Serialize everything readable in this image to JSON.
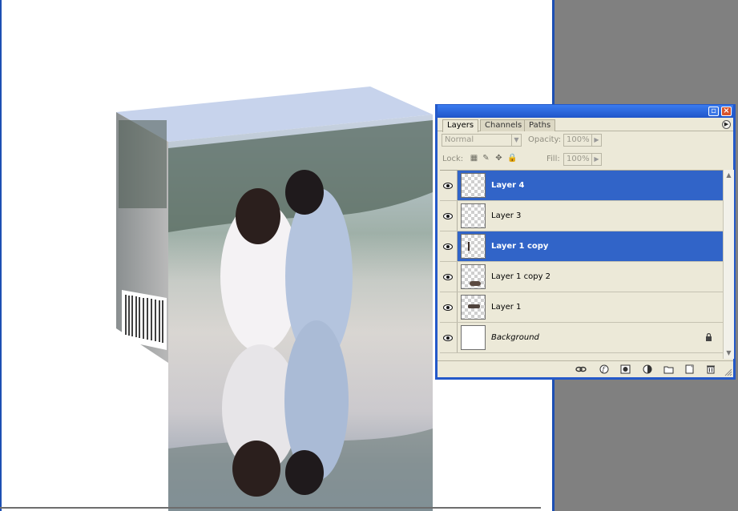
{
  "palette": {
    "tabs": [
      {
        "label": "Layers",
        "active": true
      },
      {
        "label": "Channels",
        "active": false
      },
      {
        "label": "Paths",
        "active": false
      }
    ],
    "blend_mode": "Normal",
    "opacity_label": "Opacity:",
    "opacity_value": "100%",
    "lock_label": "Lock:",
    "fill_label": "Fill:",
    "fill_value": "100%",
    "layers": [
      {
        "name": "Layer 4",
        "selected": true,
        "visible": true
      },
      {
        "name": "Layer 3",
        "selected": false,
        "visible": true
      },
      {
        "name": "Layer 1 copy",
        "selected": true,
        "visible": true
      },
      {
        "name": "Layer 1 copy 2",
        "selected": false,
        "visible": true
      },
      {
        "name": "Layer 1",
        "selected": false,
        "visible": true
      },
      {
        "name": "Background",
        "selected": false,
        "visible": true,
        "locked": true
      }
    ],
    "bottom_icons": [
      "link-layers-icon",
      "layer-style-icon",
      "layer-mask-icon",
      "adjustment-layer-icon",
      "new-group-icon",
      "new-layer-icon",
      "delete-layer-icon"
    ]
  },
  "colors": {
    "selection": "#3164c8",
    "title_bar": "#2459c9",
    "panel_bg": "#ece9d8",
    "pasteboard": "#808080"
  }
}
